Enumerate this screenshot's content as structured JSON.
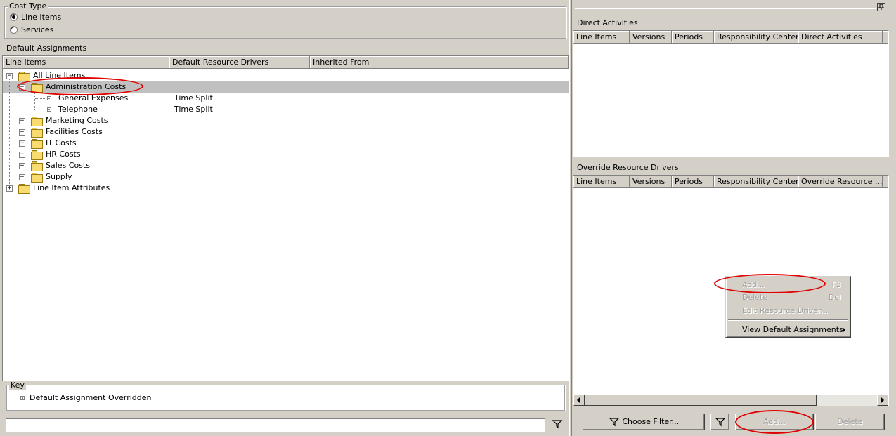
{
  "cost_type": {
    "title": "Cost Type",
    "options": [
      {
        "label": "Line Items",
        "selected": true
      },
      {
        "label": "Services",
        "selected": false
      }
    ]
  },
  "default_assignments": {
    "title": "Default Assignments",
    "columns": [
      "Line Items",
      "Default Resource Drivers",
      "Inherited From"
    ],
    "tree": [
      {
        "label": "All Line Items",
        "driver": ""
      },
      {
        "label": "Administration Costs",
        "driver": ""
      },
      {
        "label": "General Expenses",
        "driver": "Time Split"
      },
      {
        "label": "Telephone",
        "driver": "Time Split"
      },
      {
        "label": "Marketing Costs",
        "driver": ""
      },
      {
        "label": "Facilities Costs",
        "driver": ""
      },
      {
        "label": "IT Costs",
        "driver": ""
      },
      {
        "label": "HR Costs",
        "driver": ""
      },
      {
        "label": "Sales Costs",
        "driver": ""
      },
      {
        "label": "Supply",
        "driver": ""
      },
      {
        "label": "Line Item Attributes",
        "driver": ""
      }
    ],
    "expander_expanded": "−",
    "expander_collapsed": "+"
  },
  "key": {
    "title": "Key",
    "item": "Default Assignment Overridden"
  },
  "filter_bar": {
    "value": ""
  },
  "direct_activities": {
    "title": "Direct Activities",
    "columns": [
      "Line Items",
      "Versions",
      "Periods",
      "Responsibility Centers",
      "Direct Activities"
    ]
  },
  "override_resource_drivers": {
    "title": "Override Resource Drivers",
    "columns": [
      "Line Items",
      "Versions",
      "Periods",
      "Responsibility Centers",
      "Override Resource ..."
    ]
  },
  "context_menu": {
    "items": [
      {
        "label": "Add...",
        "shortcut": "F3",
        "disabled": true
      },
      {
        "label": "Delete",
        "shortcut": "Del",
        "disabled": true
      },
      {
        "label": "Edit Resource Driver...",
        "shortcut": "",
        "disabled": true
      },
      {
        "label": "View Default Assignments",
        "shortcut": "",
        "disabled": false
      }
    ]
  },
  "buttons": {
    "choose_filter": "Choose Filter...",
    "add": "Add...",
    "delete": "Delete"
  },
  "colors": {
    "annotation": "#e00000",
    "selection": "#c0c0c0",
    "face": "#d4d0c8"
  }
}
